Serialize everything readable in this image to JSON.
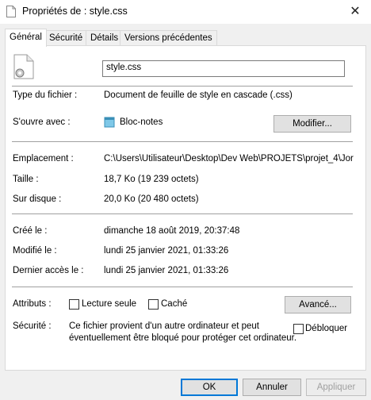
{
  "window": {
    "title": "Propriétés de : style.css"
  },
  "tabs": [
    {
      "label": "Général"
    },
    {
      "label": "Sécurité"
    },
    {
      "label": "Détails"
    },
    {
      "label": "Versions précédentes"
    }
  ],
  "file": {
    "name": "style.css"
  },
  "rows": {
    "type_label": "Type du fichier :",
    "type_value": "Document de feuille de style en cascade (.css)",
    "opens_label": "S'ouvre avec :",
    "opens_value": "Bloc-notes",
    "modify_button": "Modifier...",
    "location_label": "Emplacement :",
    "location_value": "C:\\Users\\Utilisateur\\Desktop\\Dev Web\\PROJETS\\projet_4\\Jor",
    "size_label": "Taille :",
    "size_value": "18,7 Ko (19 239 octets)",
    "disk_label": "Sur disque :",
    "disk_value": "20,0 Ko (20 480 octets)",
    "created_label": "Créé le :",
    "created_value": "dimanche 18 août 2019, 20:37:48",
    "modified_label": "Modifié le :",
    "modified_value": "lundi 25 janvier 2021, 01:33:26",
    "accessed_label": "Dernier accès le :",
    "accessed_value": "lundi 25 janvier 2021, 01:33:26",
    "attributes_label": "Attributs :",
    "readonly_label": "Lecture seule",
    "hidden_label": "Caché",
    "advanced_button": "Avancé...",
    "security_label": "Sécurité :",
    "security_text_1": "Ce fichier provient d'un autre ordinateur et peut",
    "security_text_2": "éventuellement être bloqué pour protéger cet ordinateur.",
    "unblock_label": "Débloquer"
  },
  "buttons": {
    "ok": "OK",
    "cancel": "Annuler",
    "apply": "Appliquer"
  },
  "colors": {
    "accent": "#0078d7",
    "separator": "#a0a0a0"
  }
}
